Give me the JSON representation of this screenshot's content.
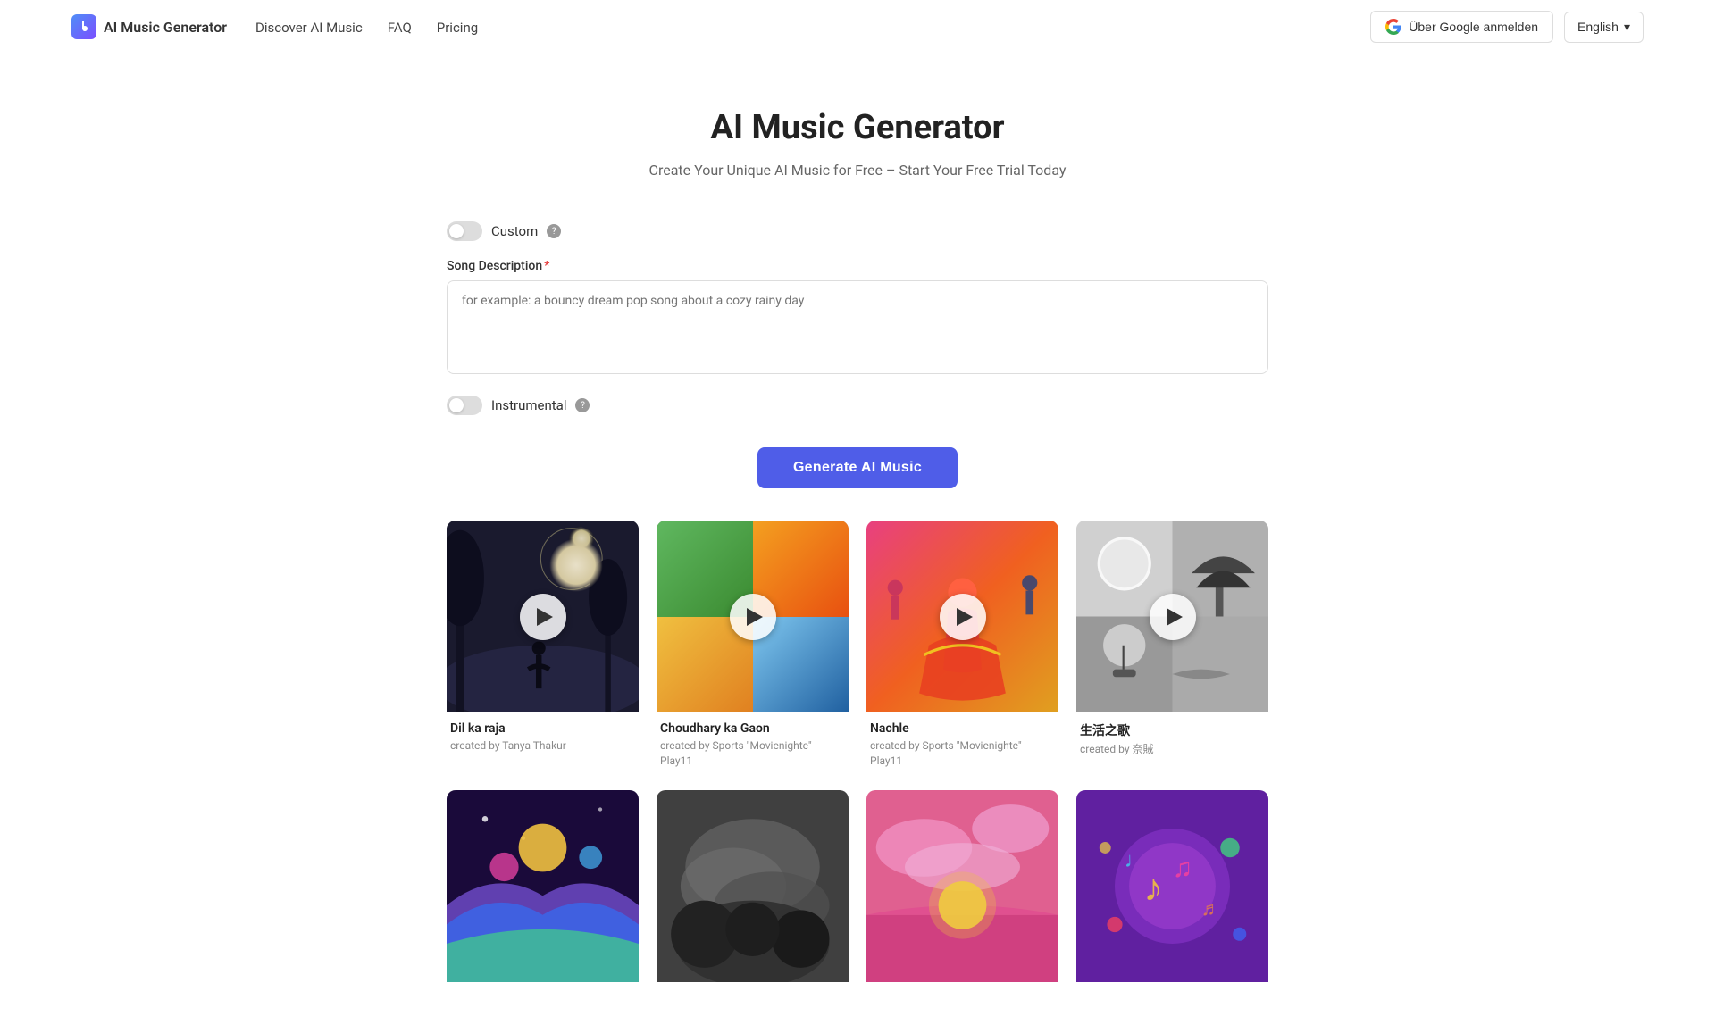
{
  "header": {
    "logo_text": "AI Music Generator",
    "nav": [
      {
        "label": "Discover AI Music",
        "href": "#"
      },
      {
        "label": "FAQ",
        "href": "#"
      },
      {
        "label": "Pricing",
        "href": "#"
      }
    ],
    "google_btn_label": "Über Google anmelden",
    "lang_label": "English",
    "lang_dropdown_icon": "▾"
  },
  "hero": {
    "title": "AI Music Generator",
    "subtitle": "Create Your Unique AI Music for Free – Start Your Free Trial Today"
  },
  "form": {
    "custom_toggle_label": "Custom",
    "custom_toggle_on": false,
    "custom_info_icon": "?",
    "song_desc_label": "Song Description",
    "song_desc_placeholder": "for example: a bouncy dream pop song about a cozy rainy day",
    "song_desc_value": "",
    "instrumental_toggle_label": "Instrumental",
    "instrumental_toggle_on": false,
    "instrumental_info_icon": "?",
    "generate_btn_label": "Generate AI Music"
  },
  "music_cards": [
    {
      "id": 1,
      "title": "Dil ka raja",
      "author": "created by Tanya Thakur",
      "bg_class": "card-bg-1"
    },
    {
      "id": 2,
      "title": "Choudhary ka Gaon",
      "author": "created by Sports \"Movienighte\" Play11",
      "bg_class": "card-bg-2"
    },
    {
      "id": 3,
      "title": "Nachle",
      "author": "created by Sports \"Movienighte\" Play11",
      "bg_class": "card-bg-3"
    },
    {
      "id": 4,
      "title": "生活之歌",
      "author": "created by 奈賊",
      "bg_class": "card-bg-4"
    },
    {
      "id": 5,
      "title": "",
      "author": "",
      "bg_class": "card-bg-5"
    },
    {
      "id": 6,
      "title": "",
      "author": "",
      "bg_class": "card-bg-6"
    },
    {
      "id": 7,
      "title": "",
      "author": "",
      "bg_class": "card-bg-7"
    },
    {
      "id": 8,
      "title": "",
      "author": "",
      "bg_class": "card-bg-8"
    }
  ]
}
